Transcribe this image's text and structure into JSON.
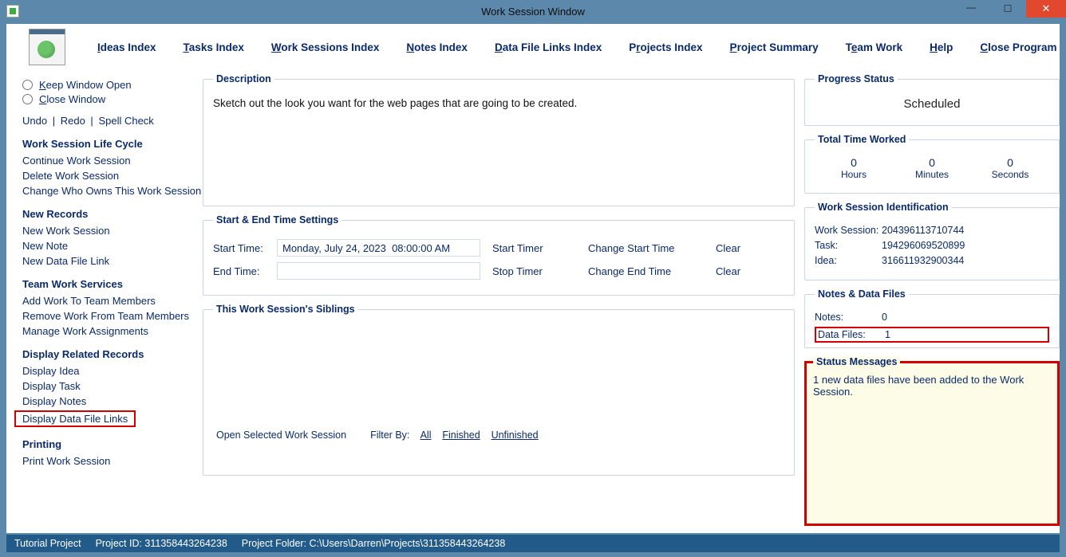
{
  "window": {
    "title": "Work Session Window"
  },
  "menu": {
    "ideas": "Ideas Index",
    "tasks": "Tasks Index",
    "worksessions": "Work Sessions Index",
    "notes": "Notes Index",
    "datafilelinks": "Data File Links Index",
    "projects": "Projects Index",
    "projectsummary": "Project Summary",
    "teamwork": "Team Work",
    "help": "Help",
    "close": "Close Program"
  },
  "sidebar": {
    "keep_open": "Keep Window Open",
    "close_window": "Close Window",
    "undo": "Undo",
    "redo": "Redo",
    "spell": "Spell Check",
    "h_lifecycle": "Work Session Life Cycle",
    "cont": "Continue Work Session",
    "del": "Delete Work Session",
    "chown": "Change Who Owns This Work Session",
    "h_new": "New Records",
    "new_ws": "New Work Session",
    "new_note": "New Note",
    "new_dfl": "New Data File Link",
    "h_team": "Team Work Services",
    "add_work": "Add Work To Team Members",
    "rem_work": "Remove Work From Team Members",
    "mgr_work": "Manage Work Assignments",
    "h_disp": "Display Related Records",
    "disp_idea": "Display Idea",
    "disp_task": "Display Task",
    "disp_notes": "Display Notes",
    "disp_dfl": "Display Data File Links",
    "h_print": "Printing",
    "print_ws": "Print Work Session"
  },
  "desc": {
    "legend": "Description",
    "body": "Sketch out the look you want for the web pages that are going to be created."
  },
  "times": {
    "legend": "Start & End Time Settings",
    "start_label": "Start Time:",
    "start_value": "Monday, July 24, 2023  08:00:00 AM",
    "start_timer": "Start Timer",
    "change_start": "Change Start Time",
    "clear_start": "Clear",
    "end_label": "End Time:",
    "end_value": "",
    "stop_timer": "Stop Timer",
    "change_end": "Change End Time",
    "clear_end": "Clear"
  },
  "siblings": {
    "legend": "This Work Session's Siblings",
    "open_sel": "Open Selected Work Session",
    "filter_label": "Filter By:",
    "all": "All",
    "finished": "Finished",
    "unfinished": "Unfinished"
  },
  "progress": {
    "legend": "Progress Status",
    "value": "Scheduled"
  },
  "worked": {
    "legend": "Total Time Worked",
    "h": "0",
    "h_lbl": "Hours",
    "m": "0",
    "m_lbl": "Minutes",
    "s": "0",
    "s_lbl": "Seconds"
  },
  "ident": {
    "legend": "Work Session Identification",
    "ws_k": "Work Session:",
    "ws_v": "204396113710744",
    "task_k": "Task:",
    "task_v": "194296069520899",
    "idea_k": "Idea:",
    "idea_v": "316611932900344"
  },
  "ndf": {
    "legend": "Notes & Data Files",
    "notes_k": "Notes:",
    "notes_v": "0",
    "df_k": "Data Files:",
    "df_v": "1"
  },
  "status": {
    "legend": "Status Messages",
    "msg": "1 new data files have been added to the Work Session."
  },
  "statusbar": {
    "proj_name": "Tutorial Project",
    "proj_id": "Project ID: 311358443264238",
    "proj_folder": "Project Folder: C:\\Users\\Darren\\Projects\\311358443264238"
  }
}
